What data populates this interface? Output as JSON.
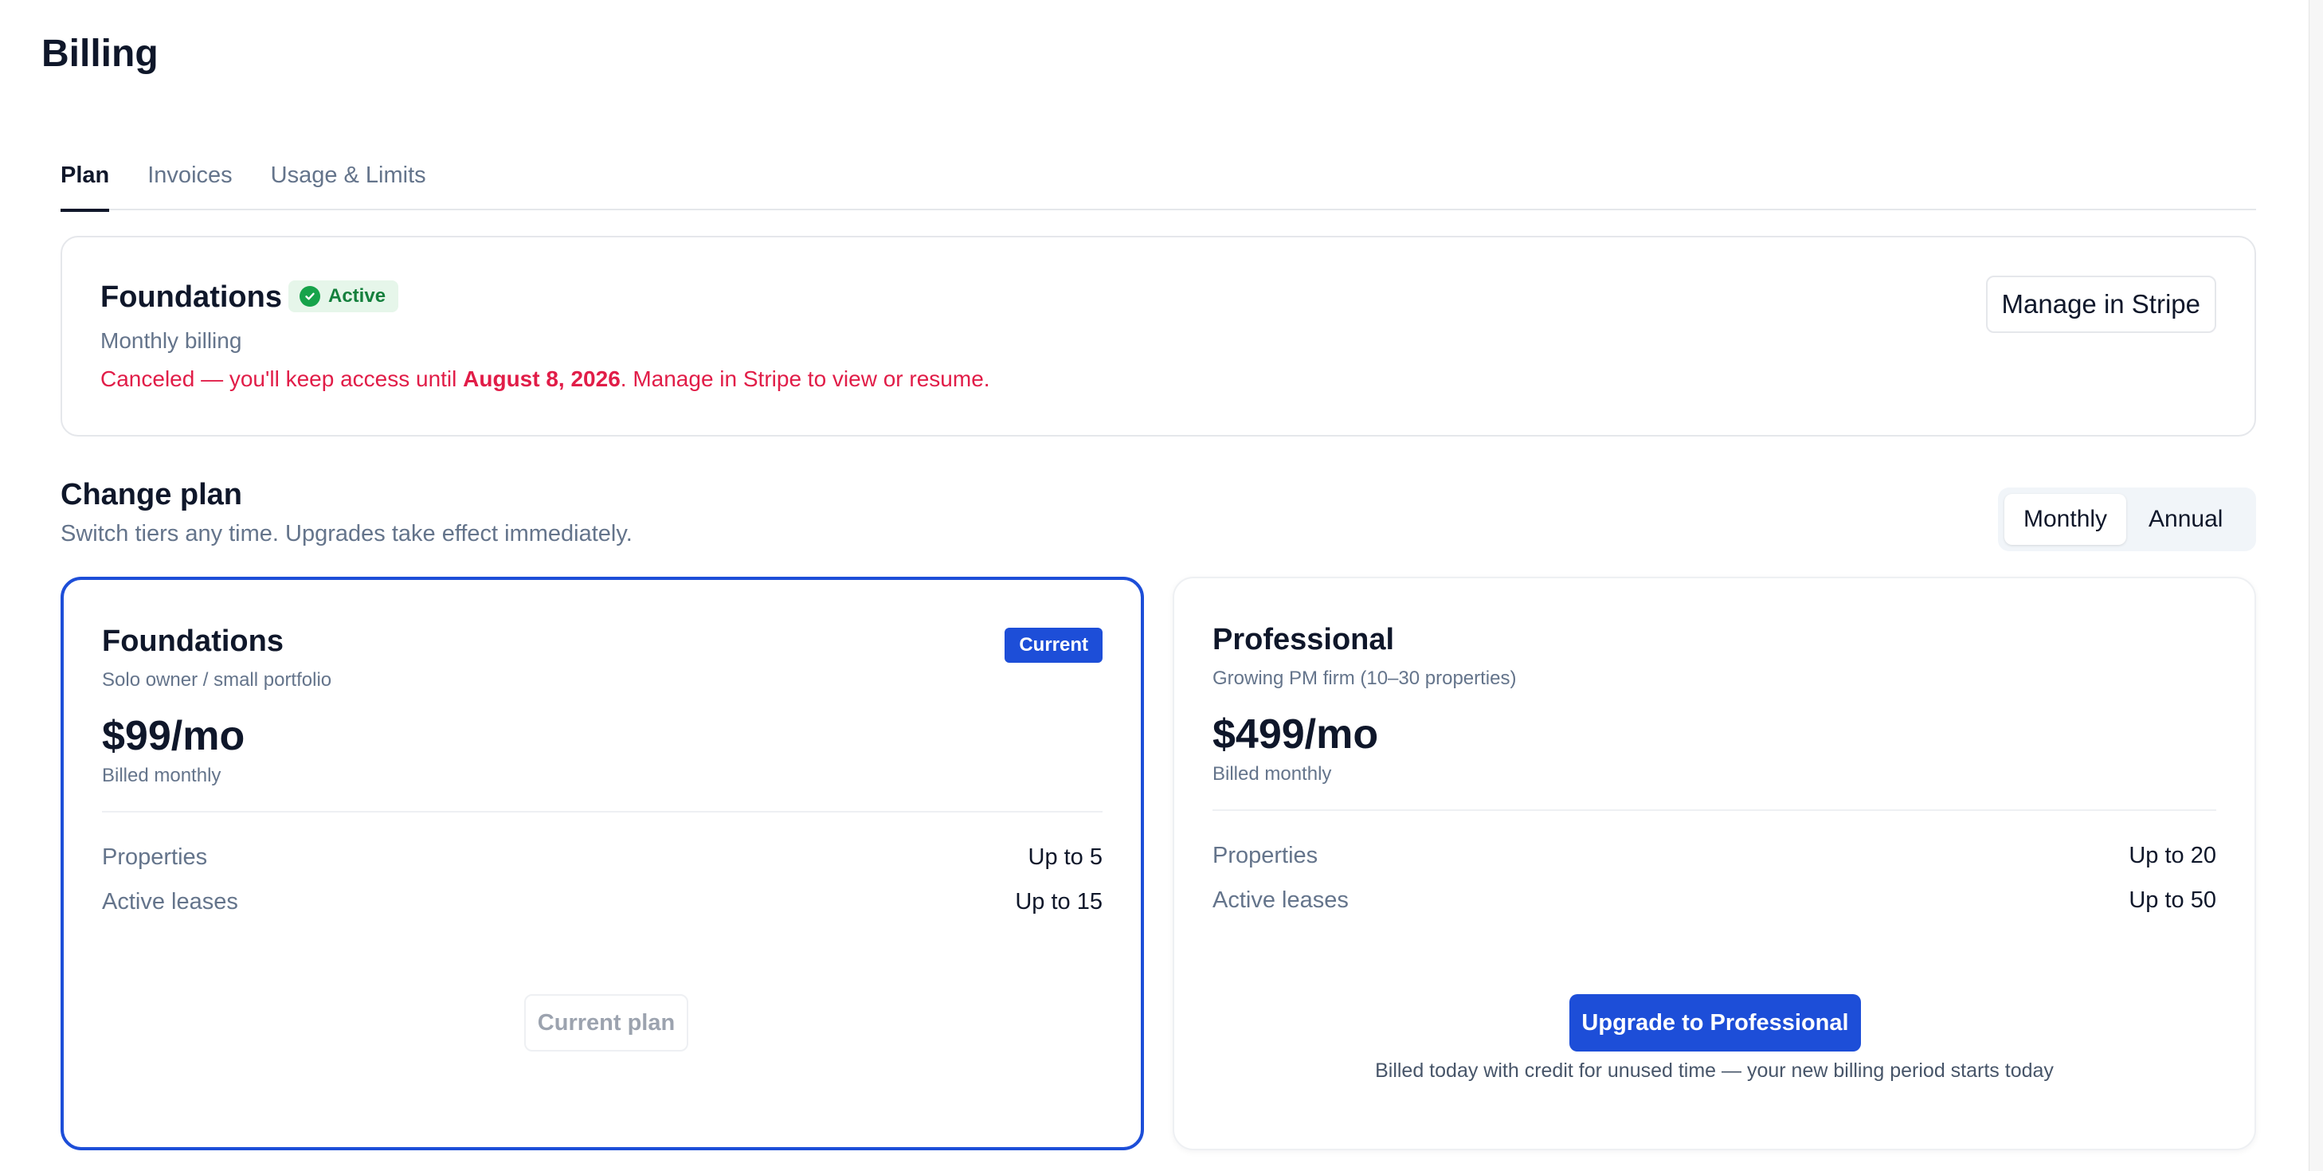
{
  "page": {
    "title": "Billing"
  },
  "tabs": [
    {
      "label": "Plan",
      "active": true
    },
    {
      "label": "Invoices",
      "active": false
    },
    {
      "label": "Usage & Limits",
      "active": false
    }
  ],
  "subscription": {
    "plan_name": "Foundations",
    "status": "Active",
    "billing": "Monthly billing",
    "notice_prefix": "Canceled — you'll keep access until ",
    "notice_date": "August 8, 2026",
    "notice_suffix": ". Manage in Stripe to view or resume.",
    "manage_button": "Manage in Stripe"
  },
  "change_plan": {
    "title": "Change plan",
    "subtitle": "Switch tiers any time. Upgrades take effect immediately.",
    "toggle": {
      "options": [
        "Monthly",
        "Annual"
      ],
      "selected": "Monthly"
    }
  },
  "plans": [
    {
      "name": "Foundations",
      "tagline": "Solo owner / small portfolio",
      "price": "$99/mo",
      "cycle": "Billed monthly",
      "badge": "Current",
      "features": [
        {
          "label": "Properties",
          "value": "Up to 5"
        },
        {
          "label": "Active leases",
          "value": "Up to 15"
        }
      ],
      "button": "Current plan"
    },
    {
      "name": "Professional",
      "tagline": "Growing PM firm (10–30 properties)",
      "price": "$499/mo",
      "cycle": "Billed monthly",
      "features": [
        {
          "label": "Properties",
          "value": "Up to 20"
        },
        {
          "label": "Active leases",
          "value": "Up to 50"
        }
      ],
      "button": "Upgrade to Professional",
      "note": "Billed today with credit for unused time — your new billing period starts today"
    }
  ],
  "colors": {
    "accent": "#1d4ed8",
    "success": "#16a34a",
    "danger": "#e11d48",
    "muted": "#64748b"
  }
}
